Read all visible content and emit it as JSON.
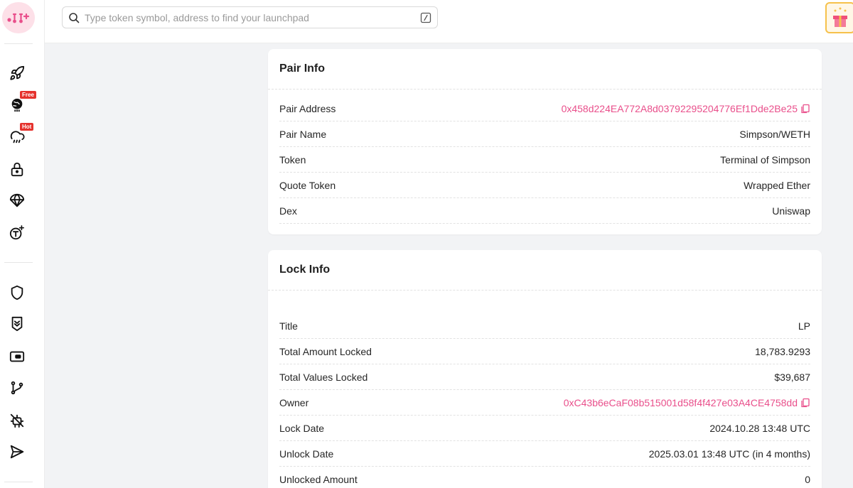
{
  "search": {
    "placeholder": "Type token symbol, address to find your launchpad"
  },
  "sidebar": {
    "badges": {
      "free": "Free",
      "hot": "Hot"
    },
    "icons": [
      "rocket-icon",
      "globe-icon",
      "cloud-rain-icon",
      "lock-icon",
      "parachute-icon",
      "token-sparkle-icon",
      "shield-icon",
      "shield-chevrons-icon",
      "card-icon",
      "git-branch-icon",
      "no-bot-icon",
      "send-icon"
    ]
  },
  "pair_info": {
    "title": "Pair Info",
    "rows": [
      {
        "label": "Pair Address",
        "value": "0x458d224EA772A8d03792295204776Ef1Dde2Be25"
      },
      {
        "label": "Pair Name",
        "value": "Simpson/WETH"
      },
      {
        "label": "Token",
        "value": "Terminal of Simpson"
      },
      {
        "label": "Quote Token",
        "value": "Wrapped Ether"
      },
      {
        "label": "Dex",
        "value": "Uniswap"
      }
    ]
  },
  "lock_info": {
    "title": "Lock Info",
    "rows": [
      {
        "label": "Title",
        "value": "LP"
      },
      {
        "label": "Total Amount Locked",
        "value": "18,783.9293"
      },
      {
        "label": "Total Values Locked",
        "value": "$39,687"
      },
      {
        "label": "Owner",
        "value": "0xC43b6eCaF08b515001d58f4f427e03A4CE4758dd"
      },
      {
        "label": "Lock Date",
        "value": "2024.10.28 13:48 UTC"
      },
      {
        "label": "Unlock Date",
        "value": "2025.03.01 13:48 UTC (in 4 months)"
      },
      {
        "label": "Unlocked Amount",
        "value": "0"
      }
    ]
  },
  "colors": {
    "accent_link": "#e94f8b",
    "badge_red": "#e5322d",
    "gift_border": "#f6c14b",
    "page_bg": "#f2f3f5"
  }
}
